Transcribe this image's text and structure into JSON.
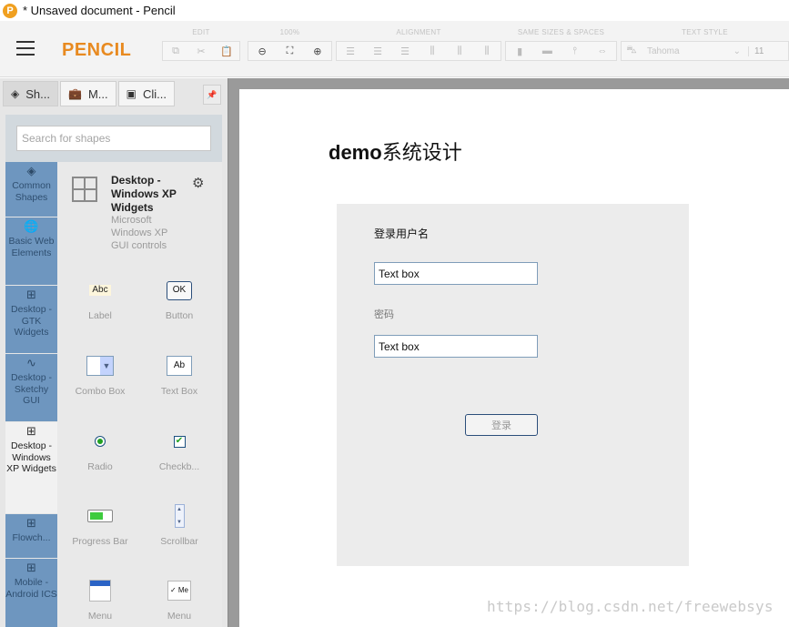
{
  "window": {
    "title": "* Unsaved document - Pencil",
    "logo_letter": "P"
  },
  "brand": {
    "name": "PENCIL",
    "color": "#e88a20"
  },
  "toolbar": {
    "groups": [
      {
        "label": "EDIT",
        "icons": [
          "copy-icon",
          "cut-icon",
          "paste-icon"
        ]
      },
      {
        "label": "100%",
        "icons": [
          "zoom-out-icon",
          "fit-icon",
          "zoom-in-icon"
        ]
      },
      {
        "label": "ALIGNMENT",
        "icons": [
          "align-left-icon",
          "align-center-icon",
          "align-right-icon",
          "align-top-icon",
          "align-middle-icon",
          "align-bottom-icon"
        ]
      },
      {
        "label": "SAME SIZES & SPACES",
        "icons": [
          "same-width-icon",
          "same-height-icon",
          "same-vspace-icon",
          "same-hspace-icon"
        ]
      },
      {
        "label": "TEXT STYLE",
        "font": "Tahoma",
        "size": "11"
      }
    ]
  },
  "sidebar": {
    "tabs": [
      {
        "label": "Sh...",
        "icon": "layers-icon"
      },
      {
        "label": "M...",
        "icon": "briefcase-icon"
      },
      {
        "label": "Cli...",
        "icon": "image-icon"
      }
    ],
    "search": {
      "placeholder": "Search for shapes",
      "value": ""
    },
    "categories": [
      {
        "label": "Common Shapes"
      },
      {
        "label": "Basic Web Elements"
      },
      {
        "label": "Desktop - GTK Widgets"
      },
      {
        "label": "Desktop - Sketchy GUI"
      },
      {
        "label": "Desktop - Windows XP Widgets"
      },
      {
        "label": "Flowch..."
      },
      {
        "label": "Mobile - Android ICS"
      }
    ],
    "collection": {
      "title": "Desktop - Windows XP Widgets",
      "description": "Microsoft Windows XP GUI controls"
    },
    "shapes": [
      {
        "label": "Label",
        "thumb": "Abc"
      },
      {
        "label": "Button",
        "thumb": "OK"
      },
      {
        "label": "Combo Box"
      },
      {
        "label": "Text Box",
        "thumb": "Ab"
      },
      {
        "label": "Radio"
      },
      {
        "label": "Checkb..."
      },
      {
        "label": "Progress Bar"
      },
      {
        "label": "Scrollbar"
      },
      {
        "label": "Menu"
      },
      {
        "label": "Menu",
        "thumb": "✓ Me"
      }
    ]
  },
  "canvas": {
    "title_latin": "demo",
    "title_cn": "系统设计",
    "form": {
      "username_label": "登录用户名",
      "username_value": "Text box",
      "password_label": "密码",
      "password_value": "Text box",
      "login_label": "登录"
    }
  },
  "watermark": "https://blog.csdn.net/freewebsys"
}
